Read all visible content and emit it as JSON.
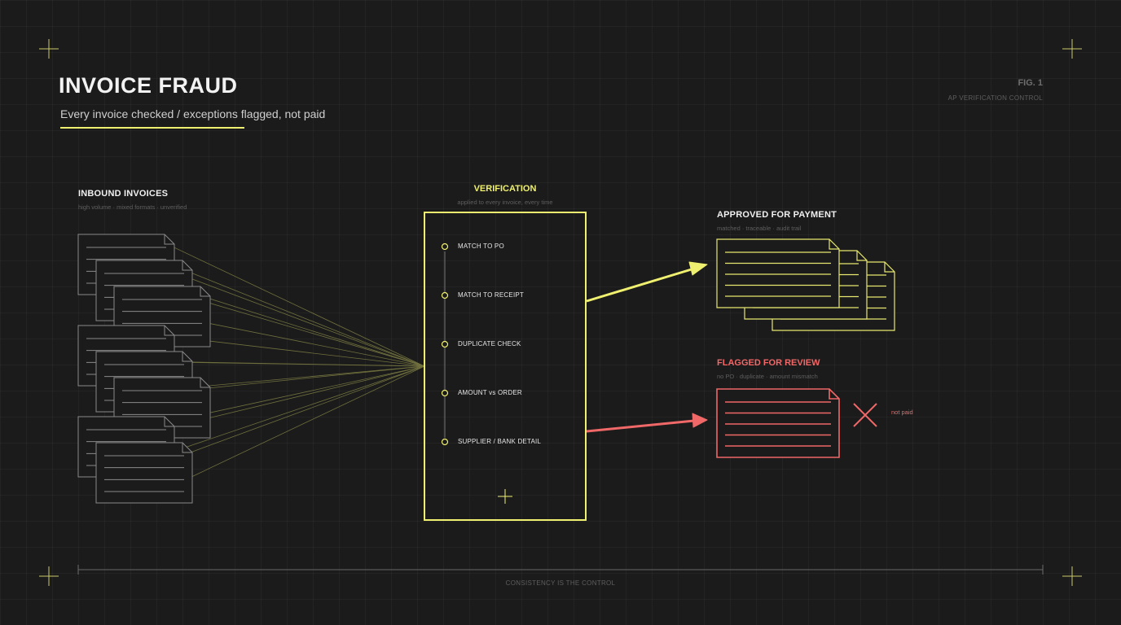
{
  "header": {
    "title": "INVOICE FRAUD",
    "subtitle": "Every invoice checked  /  exceptions flagged, not paid",
    "fig_label": "FIG. 1",
    "fig_caption": "AP VERIFICATION CONTROL"
  },
  "inbound": {
    "title": "INBOUND INVOICES",
    "subtitle": "high volume · mixed formats · unverified"
  },
  "verification": {
    "title": "VERIFICATION",
    "subtitle": "applied to every invoice, every time",
    "steps": [
      "MATCH TO PO",
      "MATCH TO RECEIPT",
      "DUPLICATE CHECK",
      "AMOUNT vs ORDER",
      "SUPPLIER / BANK DETAIL"
    ]
  },
  "approved": {
    "title": "APPROVED FOR PAYMENT",
    "subtitle": "matched · traceable · audit trail"
  },
  "flagged": {
    "title": "FLAGGED FOR REVIEW",
    "subtitle": "no PO · duplicate · amount mismatch",
    "status": "not paid"
  },
  "footer": {
    "caption": "CONSISTENCY IS THE CONTROL"
  },
  "colors": {
    "background": "#1b1b1b",
    "accent_yellow": "#f0f070",
    "accent_red": "#f06868",
    "neutral_outline": "#8a8a8a"
  }
}
